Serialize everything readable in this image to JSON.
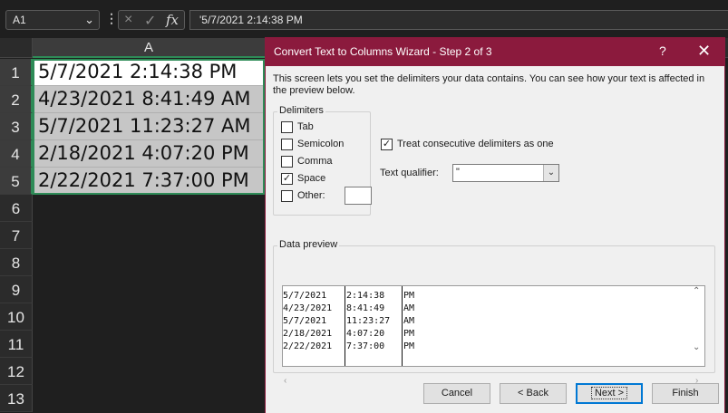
{
  "formula_bar": {
    "name_box": "A1",
    "name_box_icon": "chevron-down-icon",
    "cancel_icon": "×",
    "enter_icon": "✓",
    "fx_label": "fx",
    "formula": "'5/7/2021 2:14:38 PM"
  },
  "sheet": {
    "column_header": "A",
    "row_numbers": [
      "1",
      "2",
      "3",
      "4",
      "5",
      "6",
      "7",
      "8",
      "9",
      "10",
      "11",
      "12",
      "13"
    ],
    "cells": [
      "5/7/2021 2:14:38 PM",
      "4/23/2021 8:41:49 AM",
      "5/7/2021 11:23:27 AM",
      "2/18/2021 4:07:20 PM",
      "2/22/2021 7:37:00 PM"
    ],
    "active_cell_index": 0,
    "selection_color": "#2e8b57"
  },
  "dialog": {
    "title": "Convert Text to Columns Wizard - Step 2 of 3",
    "help": "?",
    "close": "✕",
    "title_color": "#8b1a3d",
    "description": "This screen lets you set the delimiters your data contains.  You can see how your text is affected in the preview below.",
    "delimiters_legend": "Delimiters",
    "delimiters": [
      {
        "label": "Tab",
        "checked": false
      },
      {
        "label": "Semicolon",
        "checked": false
      },
      {
        "label": "Comma",
        "checked": false
      },
      {
        "label": "Space",
        "checked": true
      },
      {
        "label": "Other:",
        "checked": false
      }
    ],
    "other_value": "",
    "consecutive": {
      "label": "Treat consecutive delimiters as one",
      "checked": true
    },
    "text_qualifier_label": "Text qualifier:",
    "text_qualifier_value": "\"",
    "preview_legend": "Data preview",
    "preview_rows": [
      [
        "5/7/2021",
        "2:14:38",
        "PM"
      ],
      [
        "4/23/2021",
        "8:41:49",
        "AM"
      ],
      [
        "5/7/2021",
        "11:23:27",
        "AM"
      ],
      [
        "2/18/2021",
        "4:07:20",
        "PM"
      ],
      [
        "2/22/2021",
        "7:37:00",
        "PM"
      ]
    ],
    "buttons": {
      "cancel": "Cancel",
      "back": "< Back",
      "next": "Next >",
      "finish": "Finish"
    }
  }
}
